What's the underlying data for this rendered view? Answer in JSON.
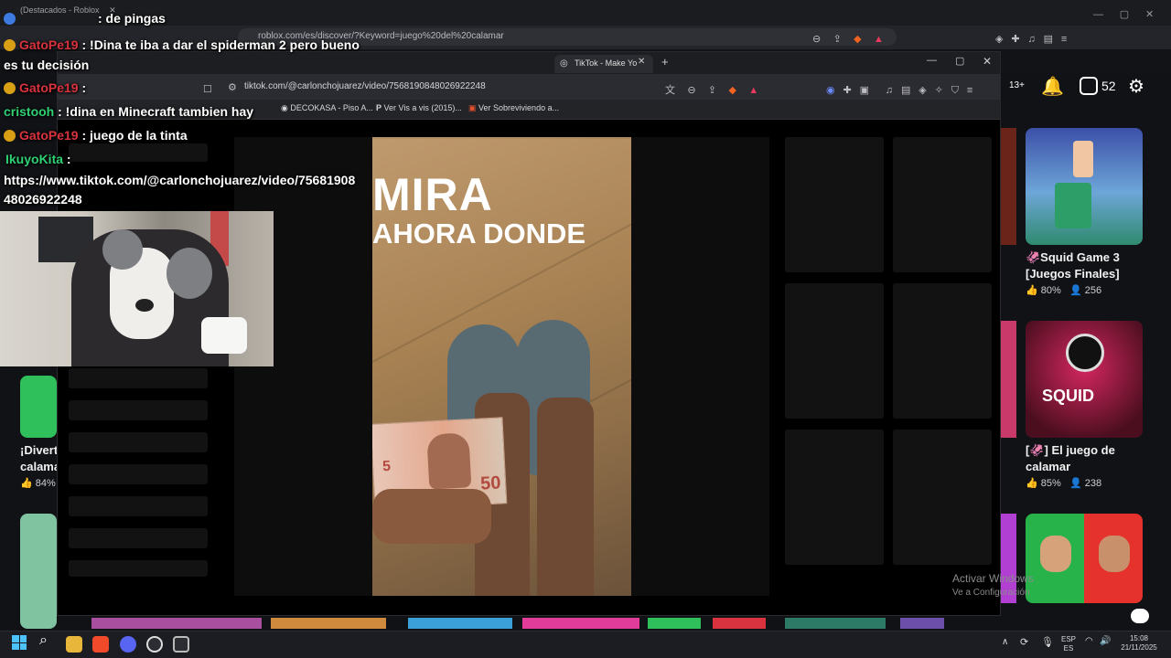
{
  "back_browser": {
    "tab_label": "(Destacados - Roblox",
    "url": "roblox.com/es/discover/?Keyword=juego%20del%20calamar",
    "bell_badge": "13+",
    "robux_count": "52"
  },
  "roblox_games": [
    {
      "title": "🦑Squid Game 3 [Juegos Finales]",
      "rating": "80%",
      "players": "256"
    },
    {
      "title": "[🦑] El juego de calamar",
      "rating": "85%",
      "players": "238"
    },
    {
      "title": "¡Divert... calamar",
      "rating": "84%",
      "players": ""
    }
  ],
  "front_browser": {
    "tab_label": "TikTok - Make Yo",
    "url": "tiktok.com/@carlonchojuarez/video/7568190848026922248",
    "bookmarks": [
      "DECOKASA - Piso A...",
      "Ver Vis a vis (2015)...",
      "Ver Sobreviviendo a..."
    ],
    "video_caption_line1": "MIRA",
    "video_caption_line2": "AHORA DONDE",
    "bill_value": "50"
  },
  "chat": [
    {
      "user": "",
      "message": ": de pingas"
    },
    {
      "user": "GatoPe19",
      "message": ": !Dina te iba a dar el spiderman 2 pero bueno"
    },
    {
      "user": "",
      "message": "es tu decisión"
    },
    {
      "user": "GatoPe19",
      "message": ":"
    },
    {
      "user": "cristooh",
      "message": ": !dina en Minecraft tambien hay"
    },
    {
      "user": "GatoPe19",
      "message": ": juego de la tinta"
    },
    {
      "user": "IkuyoKita",
      "message": ":"
    },
    {
      "user": "",
      "message": "https://www.tiktok.com/@carlonchojuarez/video/75681908"
    },
    {
      "user": "",
      "message": "48026922248"
    }
  ],
  "watermark": {
    "line1": "Activar Windows",
    "line2": "Ve a Configuración"
  },
  "taskbar": {
    "lang": "ESP",
    "lang_sub": "ES",
    "time": "15:08",
    "date": "21/11/2025"
  },
  "colors": {
    "chat_red_user": "#d8333f",
    "chat_green_user": "#2fd174",
    "background": "#0b0b0c"
  }
}
